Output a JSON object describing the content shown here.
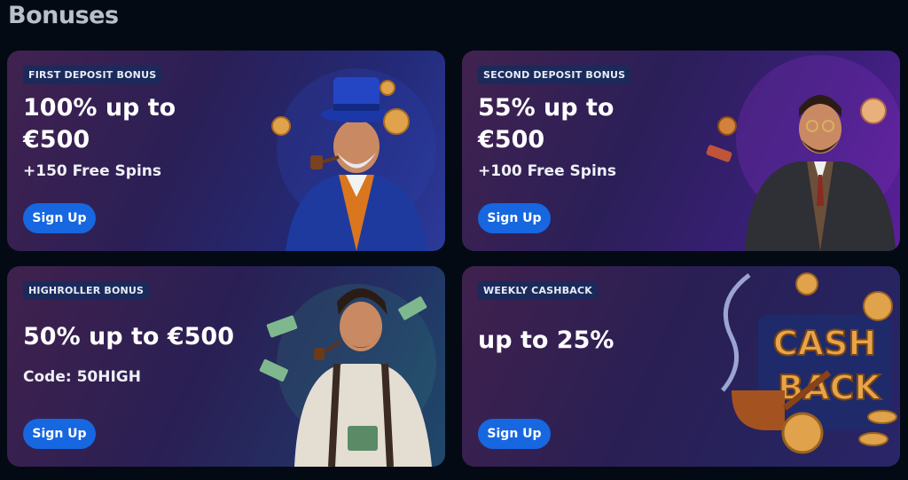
{
  "section": {
    "title": "Bonuses"
  },
  "cards": [
    {
      "badge": "FIRST DEPOSIT BONUS",
      "headline": "100% up to €500",
      "sub": "+150 Free Spins",
      "button": "Sign Up",
      "illustration": "wizard-gentleman-with-pipe-and-coins"
    },
    {
      "badge": "SECOND DEPOSIT BONUS",
      "headline": "55% up to €500",
      "sub": "+100 Free Spins",
      "button": "Sign Up",
      "illustration": "bearded-man-in-suit-with-chips"
    },
    {
      "badge": "HIGHROLLER BONUS",
      "headline": "50% up to €500",
      "sub": "Code: 50HIGH",
      "button": "Sign Up",
      "illustration": "man-with-pipe-and-cash"
    },
    {
      "badge": "WEEKLY CASHBACK",
      "headline": "up to 25%",
      "sub": "",
      "button": "Sign Up",
      "illustration": "cash-back-logo-with-pipe-and-coins"
    }
  ],
  "colors": {
    "background": "#040a14",
    "button": "#1667e0",
    "badge_bg": "#1b2a5a",
    "title": "#b8c0cc"
  }
}
